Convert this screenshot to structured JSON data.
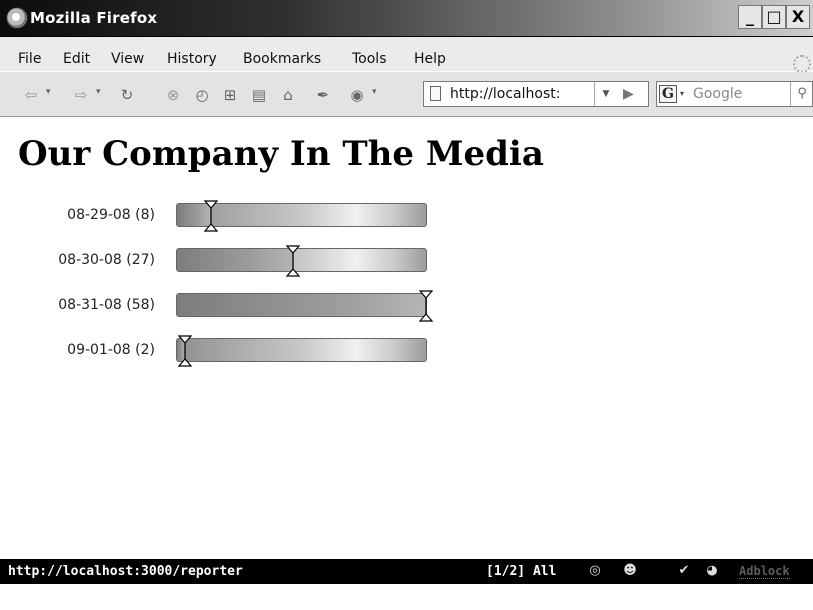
{
  "window": {
    "title": "Mozilla Firefox",
    "minimize": "_",
    "maximize": "□",
    "close": "X"
  },
  "menu": [
    "File",
    "Edit",
    "View",
    "History",
    "Bookmarks",
    "Tools",
    "Help"
  ],
  "toolbar": {
    "icons": [
      "back-arrow-icon",
      "forward-arrow-icon",
      "reload-icon",
      "stop-icon",
      "history-icon",
      "new-tab-icon",
      "print-icon",
      "home-icon",
      "bookmark-icon",
      "addon-icon",
      "page-icon",
      "go-icon",
      "google-g-icon",
      "magnifier-icon"
    ],
    "url": "http://localhost:",
    "search_engine_letter": "G",
    "search_placeholder": "Google"
  },
  "page": {
    "heading": "Our Company In The Media",
    "meters": [
      {
        "label": "08-29-08 (8)",
        "fraction": 0.138
      },
      {
        "label": "08-30-08 (27)",
        "fraction": 0.466
      },
      {
        "label": "08-31-08 (58)",
        "fraction": 1.0
      },
      {
        "label": "09-01-08 (2)",
        "fraction": 0.034
      }
    ]
  },
  "status": {
    "url": "http://localhost:3000/reporter",
    "tabs": "[1/2] All",
    "adblock": "Adblock"
  }
}
